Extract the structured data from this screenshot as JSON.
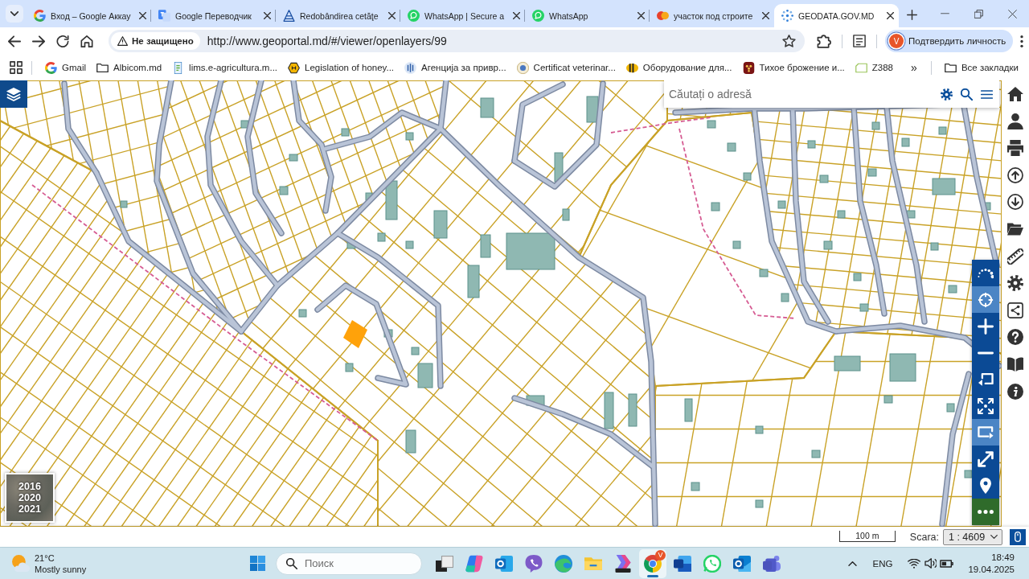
{
  "browser": {
    "tabs": [
      {
        "title": "Вход – Google Аккау",
        "kind": "google",
        "selected": false
      },
      {
        "title": "Google Переводчик",
        "kind": "translate",
        "selected": false
      },
      {
        "title": "Redobândirea cetăţe",
        "kind": "pyramid",
        "selected": false
      },
      {
        "title": "WhatsApp | Secure a",
        "kind": "whatsapp",
        "selected": false
      },
      {
        "title": "WhatsApp",
        "kind": "whatsapp",
        "selected": false
      },
      {
        "title": "участок под строите",
        "kind": "blob",
        "selected": false
      },
      {
        "title": "GEODATA.GOV.MD",
        "kind": "dots",
        "selected": true
      }
    ],
    "address_bar": {
      "security_label": "Не защищено",
      "url": "http://www.geoportal.md/#/viewer/openlayers/99"
    },
    "profile_button": {
      "avatar": "V",
      "label": "Подтвердить личность"
    },
    "bookmarks": [
      {
        "label": "Gmail",
        "kind": "google"
      },
      {
        "label": "Albicom.md",
        "kind": "folder"
      },
      {
        "label": "lims.e-agricultura.m...",
        "kind": "lims"
      },
      {
        "label": "Legislation of honey...",
        "kind": "hexagon"
      },
      {
        "label": "Агенција за привр...",
        "kind": "agency"
      },
      {
        "label": "Certificat veterinar...",
        "kind": "seal"
      },
      {
        "label": "Оборудование для...",
        "kind": "bee"
      },
      {
        "label": "Тихое брожение и...",
        "kind": "grapes"
      },
      {
        "label": "Z388",
        "kind": "tag"
      }
    ],
    "overflow": "»",
    "all_bookmarks": "Все закладки"
  },
  "map": {
    "search": {
      "placeholder": "Căutați o adresă"
    },
    "imagery_years": [
      "2016",
      "2020",
      "2021"
    ],
    "zoom_toolbar": [
      {
        "kind": "spinner",
        "active": false
      },
      {
        "kind": "locate",
        "active": true
      },
      {
        "kind": "plus",
        "active": false
      },
      {
        "kind": "minus",
        "active": false
      },
      {
        "kind": "back",
        "active": false
      },
      {
        "kind": "extent",
        "active": false
      },
      {
        "kind": "forward",
        "active": true
      },
      {
        "kind": "fullscreen",
        "active": false
      },
      {
        "kind": "pin",
        "active": false
      },
      {
        "kind": "more",
        "active": false
      }
    ],
    "side_tools": [
      {
        "kind": "home"
      },
      {
        "kind": "user"
      },
      {
        "kind": "print"
      },
      {
        "kind": "upload"
      },
      {
        "kind": "download"
      },
      {
        "kind": "folder"
      },
      {
        "kind": "ruler"
      },
      {
        "kind": "settings"
      },
      {
        "kind": "share"
      },
      {
        "kind": "help"
      },
      {
        "kind": "book"
      },
      {
        "kind": "info"
      }
    ],
    "scale_bar": "100 m",
    "scale_label": "Scara:",
    "scale_value": "1 : 4609"
  },
  "taskbar": {
    "weather": {
      "temperature": "21°C",
      "condition": "Mostly sunny"
    },
    "search": {
      "placeholder": "Поиск"
    },
    "apps": [
      {
        "kind": "taskview",
        "active": false
      },
      {
        "kind": "copilot",
        "active": false
      },
      {
        "kind": "outlook",
        "active": false
      },
      {
        "kind": "viber",
        "active": false
      },
      {
        "kind": "edge",
        "active": false
      },
      {
        "kind": "explorer",
        "active": false
      },
      {
        "kind": "m365",
        "active": false
      },
      {
        "kind": "chrome",
        "active": true,
        "badge": "V"
      },
      {
        "kind": "word",
        "active": false
      },
      {
        "kind": "whatsapp",
        "active": false
      },
      {
        "kind": "outlooknew",
        "active": false
      },
      {
        "kind": "teams",
        "active": false
      }
    ],
    "tray": {
      "language": "ENG",
      "time": "18:49",
      "date": "19.04.2025"
    }
  }
}
